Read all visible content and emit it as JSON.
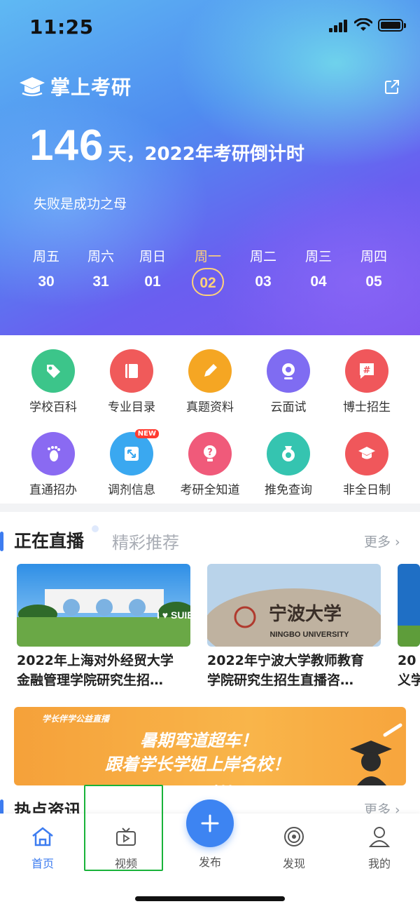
{
  "status_bar": {
    "time": "11:25"
  },
  "header": {
    "app_name": "掌上考研"
  },
  "countdown": {
    "days": "146",
    "suffix": "天，2022年考研倒计时",
    "motto": "失败是成功之母"
  },
  "week": [
    {
      "weekday": "周五",
      "date": "30"
    },
    {
      "weekday": "周六",
      "date": "31"
    },
    {
      "weekday": "周日",
      "date": "01"
    },
    {
      "weekday": "周一",
      "date": "02",
      "active": true
    },
    {
      "weekday": "周二",
      "date": "03"
    },
    {
      "weekday": "周三",
      "date": "04"
    },
    {
      "weekday": "周四",
      "date": "05"
    }
  ],
  "shortcuts": [
    {
      "label": "学校百科",
      "icon": "tag-icon",
      "color": "#3cc58a"
    },
    {
      "label": "专业目录",
      "icon": "book-icon",
      "color": "#f05a5a"
    },
    {
      "label": "真题资料",
      "icon": "pencil-icon",
      "color": "#f5a623"
    },
    {
      "label": "云面试",
      "icon": "webcam-icon",
      "color": "#7f6cf2"
    },
    {
      "label": "博士招生",
      "icon": "hashtag-icon",
      "color": "#f0575b"
    },
    {
      "label": "直通招办",
      "icon": "footprint-icon",
      "color": "#8a6af2"
    },
    {
      "label": "调剂信息",
      "icon": "swap-icon",
      "color": "#3aa8f0",
      "badge": "NEW"
    },
    {
      "label": "考研全知道",
      "icon": "question-icon",
      "color": "#f05a7a"
    },
    {
      "label": "推免查询",
      "icon": "medal-icon",
      "color": "#35c4b0"
    },
    {
      "label": "非全日制",
      "icon": "graduation-cap-icon",
      "color": "#f0575b"
    }
  ],
  "live": {
    "tab_active": "正在直播",
    "tab_inactive": "精彩推荐",
    "more": "更多",
    "cards": [
      {
        "title_line1": "2022年上海对外经贸大学",
        "title_line2": "金融管理学院研究生招…",
        "image_text": "I ♥ SUIB"
      },
      {
        "title_line1": "2022年宁波大学教师教育",
        "title_line2": "学院研究生招生直播咨…",
        "image_text_cn": "宁波大学",
        "image_text_en": "NINGBO UNIVERSITY"
      },
      {
        "title_line1": "20",
        "title_line2": "义学"
      }
    ]
  },
  "banner": {
    "brand": "学长伴学公益直播",
    "line1": "暑期弯道超车！",
    "line2": "跟着学长学姐上岸名校！"
  },
  "hot": {
    "title": "热点资讯",
    "more": "更多"
  },
  "tabbar": {
    "home": "首页",
    "video": "视频",
    "publish": "发布",
    "discover": "发现",
    "mine": "我的"
  }
}
